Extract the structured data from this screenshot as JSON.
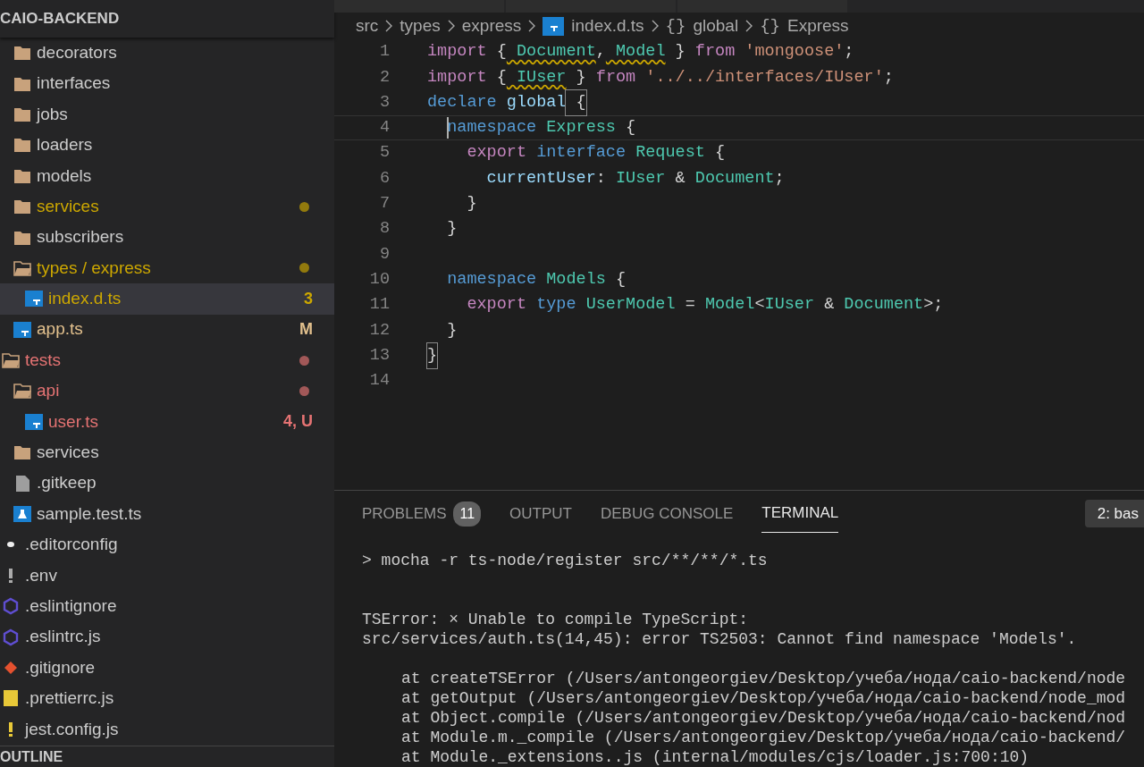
{
  "explorer": {
    "title": "CAIO-BACKEND",
    "src_items": [
      {
        "label": "decorators",
        "kind": "folder",
        "selected": false
      },
      {
        "label": "interfaces",
        "kind": "folder",
        "selected": false
      },
      {
        "label": "jobs",
        "kind": "folder",
        "selected": false
      },
      {
        "label": "loaders",
        "kind": "folder",
        "selected": false
      },
      {
        "label": "models",
        "kind": "folder",
        "selected": false
      },
      {
        "label": "services",
        "kind": "folder",
        "color": "#cca700",
        "dot": true,
        "selected": false
      },
      {
        "label": "subscribers",
        "kind": "folder",
        "selected": false
      },
      {
        "label": "types / express",
        "kind": "folder-open",
        "color": "#cca700",
        "dot": true,
        "selected": false,
        "children": [
          {
            "label": "index.d.ts",
            "kind": "ts",
            "color": "#cca700",
            "badge": "3",
            "selected": true
          }
        ]
      },
      {
        "label": "app.ts",
        "kind": "ts",
        "color": "#e2c08d",
        "badge": "M",
        "selected": false
      }
    ],
    "root_items": [
      {
        "label": "tests",
        "kind": "folder-open",
        "color": "#e57373",
        "dot": true,
        "selected": false,
        "children": [
          {
            "label": "api",
            "kind": "folder-open",
            "color": "#e57373",
            "dot": true,
            "selected": false,
            "children": [
              {
                "label": "user.ts",
                "kind": "ts",
                "color": "#e57373",
                "badge": "4, U",
                "selected": false
              }
            ]
          },
          {
            "label": "services",
            "kind": "folder",
            "selected": false
          },
          {
            "label": ".gitkeep",
            "kind": "file",
            "selected": false
          },
          {
            "label": "sample.test.ts",
            "kind": "test",
            "selected": false
          }
        ]
      },
      {
        "label": ".editorconfig",
        "kind": "editorconfig",
        "selected": false
      },
      {
        "label": ".env",
        "kind": "env",
        "selected": false
      },
      {
        "label": ".eslintignore",
        "kind": "eslint",
        "selected": false
      },
      {
        "label": ".eslintrc.js",
        "kind": "eslint",
        "selected": false
      },
      {
        "label": ".gitignore",
        "kind": "git",
        "selected": false
      },
      {
        "label": ".prettierrc.js",
        "kind": "js",
        "selected": false
      },
      {
        "label": "jest.config.js",
        "kind": "jest",
        "selected": false
      }
    ],
    "outline_title": "OUTLINE"
  },
  "breadcrumbs": [
    {
      "label": "src",
      "kind": "plain"
    },
    {
      "label": "types",
      "kind": "plain"
    },
    {
      "label": "express",
      "kind": "plain"
    },
    {
      "label": "index.d.ts",
      "kind": "ts"
    },
    {
      "label": "global",
      "kind": "symbol",
      "icon": "{}"
    },
    {
      "label": "Express",
      "kind": "symbol",
      "icon": "{}"
    }
  ],
  "code_lines": [
    {
      "number": "1",
      "current": false,
      "tokens": [
        {
          "text": "import",
          "kind": "control"
        },
        {
          "text": " {",
          "kind": "punct"
        },
        {
          "text": " Document",
          "kind": "type-warning"
        },
        {
          "text": ",",
          "kind": "punct"
        },
        {
          "text": " Model",
          "kind": "type-warning"
        },
        {
          "text": " }",
          "kind": "punct"
        },
        {
          "text": " from",
          "kind": "control"
        },
        {
          "text": " 'mongoose'",
          "kind": "string"
        },
        {
          "text": ";",
          "kind": "punct"
        }
      ]
    },
    {
      "number": "2",
      "current": false,
      "tokens": [
        {
          "text": "import",
          "kind": "control"
        },
        {
          "text": " {",
          "kind": "punct"
        },
        {
          "text": " IUser",
          "kind": "type-warning"
        },
        {
          "text": " }",
          "kind": "punct"
        },
        {
          "text": " from",
          "kind": "control"
        },
        {
          "text": " '../../interfaces/IUser'",
          "kind": "string"
        },
        {
          "text": ";",
          "kind": "punct"
        }
      ]
    },
    {
      "number": "3",
      "current": false,
      "tokens": [
        {
          "text": "declare",
          "kind": "keyword"
        },
        {
          "text": " global",
          "kind": "variable"
        },
        {
          "text": " {",
          "kind": "bracket-match"
        }
      ]
    },
    {
      "number": "4",
      "current": true,
      "tokens": [
        {
          "text": "  namespace",
          "kind": "keyword"
        },
        {
          "text": " Express",
          "kind": "type"
        },
        {
          "text": " {",
          "kind": "punct"
        }
      ]
    },
    {
      "number": "5",
      "current": false,
      "tokens": [
        {
          "text": "    export",
          "kind": "control"
        },
        {
          "text": " interface",
          "kind": "keyword"
        },
        {
          "text": " Request",
          "kind": "type"
        },
        {
          "text": " {",
          "kind": "punct"
        }
      ]
    },
    {
      "number": "6",
      "current": false,
      "tokens": [
        {
          "text": "      currentUser",
          "kind": "variable"
        },
        {
          "text": ":",
          "kind": "punct"
        },
        {
          "text": " IUser",
          "kind": "type"
        },
        {
          "text": " &",
          "kind": "punct"
        },
        {
          "text": " Document",
          "kind": "type"
        },
        {
          "text": ";",
          "kind": "punct"
        }
      ]
    },
    {
      "number": "7",
      "current": false,
      "tokens": [
        {
          "text": "    }",
          "kind": "punct"
        }
      ]
    },
    {
      "number": "8",
      "current": false,
      "tokens": [
        {
          "text": "  }",
          "kind": "punct"
        }
      ]
    },
    {
      "number": "9",
      "current": false
    },
    {
      "number": "10",
      "current": false,
      "tokens": [
        {
          "text": "  namespace",
          "kind": "keyword"
        },
        {
          "text": " Models",
          "kind": "type"
        },
        {
          "text": " {",
          "kind": "punct"
        }
      ]
    },
    {
      "number": "11",
      "current": false,
      "tokens": [
        {
          "text": "    export",
          "kind": "control"
        },
        {
          "text": " type",
          "kind": "keyword"
        },
        {
          "text": " UserModel",
          "kind": "type"
        },
        {
          "text": " =",
          "kind": "punct"
        },
        {
          "text": " Model",
          "kind": "type"
        },
        {
          "text": "<",
          "kind": "punct"
        },
        {
          "text": "IUser",
          "kind": "type"
        },
        {
          "text": " &",
          "kind": "punct"
        },
        {
          "text": " Document",
          "kind": "type"
        },
        {
          "text": ">;",
          "kind": "punct"
        }
      ]
    },
    {
      "number": "12",
      "current": false,
      "tokens": [
        {
          "text": "  }",
          "kind": "punct"
        }
      ]
    },
    {
      "number": "13",
      "current": false,
      "tokens": [
        {
          "text": "}",
          "kind": "bracket-match"
        }
      ]
    },
    {
      "number": "14",
      "current": false
    }
  ],
  "panel": {
    "tabs": [
      {
        "label": "PROBLEMS",
        "count": "11",
        "selected": false
      },
      {
        "label": "OUTPUT",
        "selected": false
      },
      {
        "label": "DEBUG CONSOLE",
        "selected": false
      },
      {
        "label": "TERMINAL",
        "selected": true
      }
    ],
    "terminal_select": "2: bas",
    "terminal_blocks": [
      {
        "lines": [
          {
            "text": "> mocha -r ts-node/register src/**/**/*.ts",
            "kind": "command"
          }
        ]
      },
      {
        "lines": [
          {
            "text": "TSError: × Unable to compile TypeScript:",
            "kind": "error"
          },
          {
            "text": "src/services/auth.ts(14,45): error TS2503: Cannot find namespace 'Models'.",
            "kind": "error"
          }
        ]
      },
      {
        "lines": [
          {
            "text": "at createTSError (/Users/antongeorgiev/Desktop/учеба/нода/caio-backend/node",
            "kind": "trace"
          },
          {
            "text": "at getOutput (/Users/antongeorgiev/Desktop/учеба/нода/caio-backend/node_mod",
            "kind": "trace"
          },
          {
            "text": "at Object.compile (/Users/antongeorgiev/Desktop/учеба/нода/caio-backend/nod",
            "kind": "trace"
          },
          {
            "text": "at Module.m._compile (/Users/antongeorgiev/Desktop/учеба/нода/caio-backend/",
            "kind": "trace"
          },
          {
            "text": "at Module._extensions..js (internal/modules/cjs/loader.js:700:10)",
            "kind": "trace"
          }
        ]
      }
    ]
  }
}
